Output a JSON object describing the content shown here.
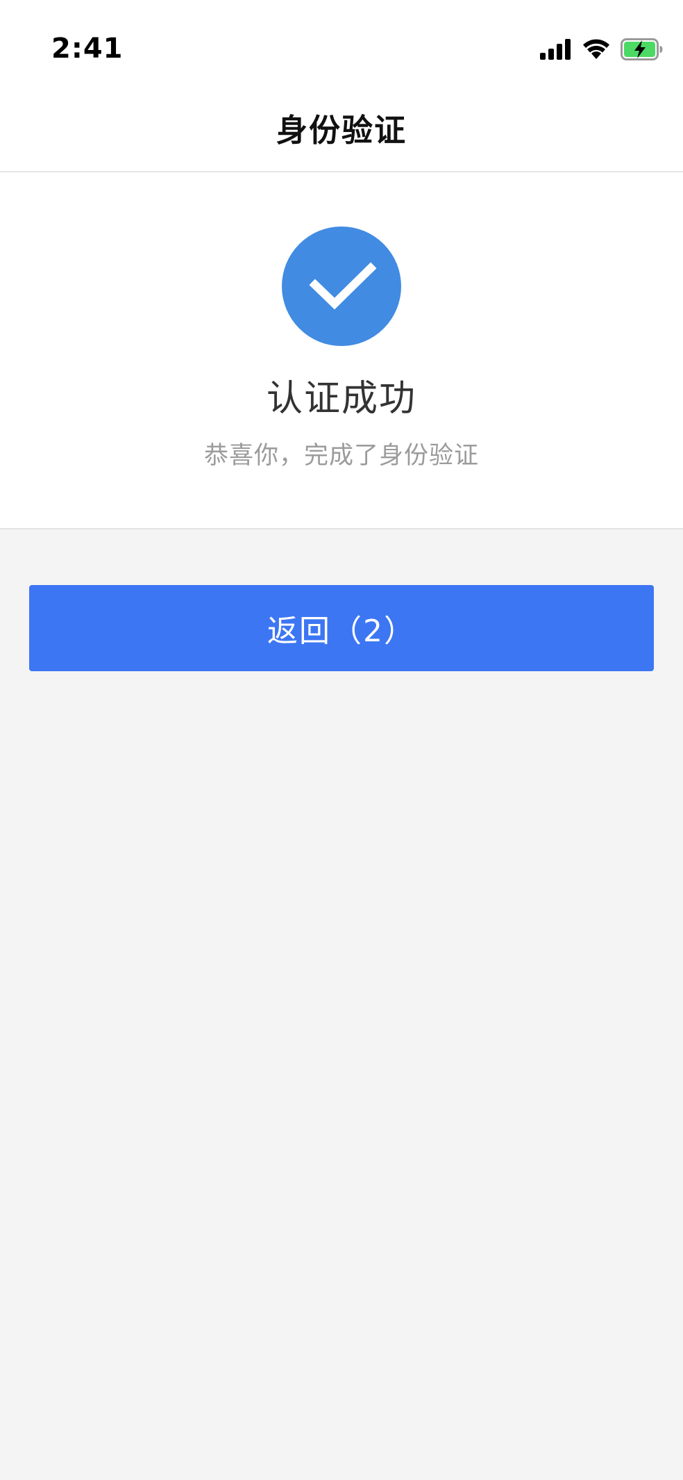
{
  "status_bar": {
    "time": "2:41",
    "icons": [
      "cellular-signal-icon",
      "wifi-icon",
      "battery-charging-icon"
    ]
  },
  "nav": {
    "title": "身份验证"
  },
  "result": {
    "icon": "checkmark-circle-icon",
    "title": "认证成功",
    "subtitle": "恭喜你，完成了身份验证"
  },
  "actions": {
    "back_label": "返回（2）"
  },
  "colors": {
    "primary_button": "#3d76f3",
    "success_icon": "#418be2",
    "battery_green": "#4cd964",
    "page_background": "#f4f4f5"
  }
}
